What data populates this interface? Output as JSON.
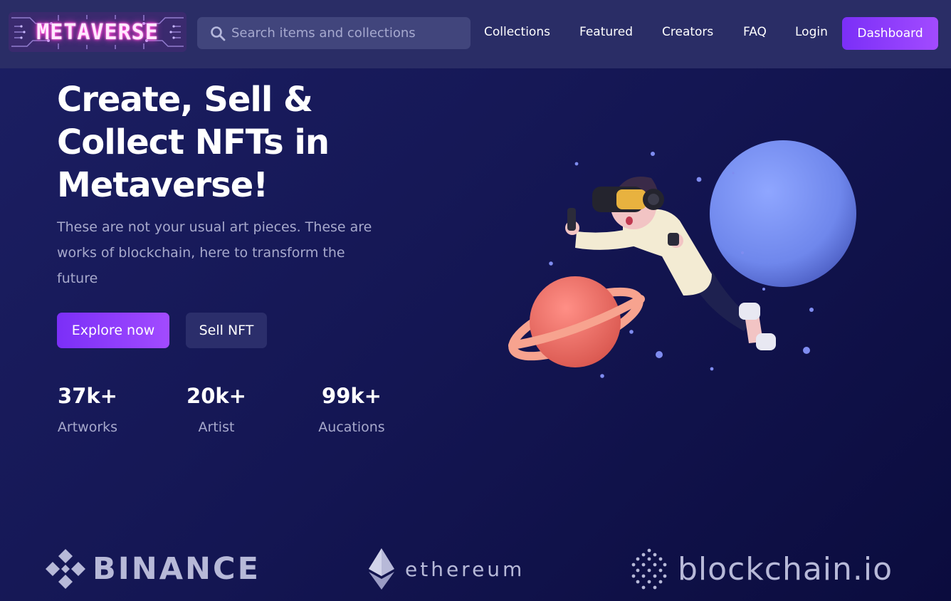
{
  "header": {
    "logo_text": "METAVERSE",
    "search_placeholder": "Search items and collections",
    "nav": [
      {
        "label": "Collections"
      },
      {
        "label": "Featured"
      },
      {
        "label": "Creators"
      },
      {
        "label": "FAQ"
      },
      {
        "label": "Login"
      }
    ],
    "dashboard_label": "Dashboard"
  },
  "hero": {
    "title_lines": [
      "Create, Sell &",
      "Collect NFTs in",
      "Metaverse!"
    ],
    "description_lines": [
      "These are not your usual art pieces. These are",
      "works of blockchain, here to transform the",
      "future"
    ],
    "explore_label": "Explore now",
    "sell_label": "Sell NFT"
  },
  "stats": [
    {
      "value": "37k+",
      "label": "Artworks"
    },
    {
      "value": "20k+",
      "label": "Artist"
    },
    {
      "value": "99k+",
      "label": "Aucations"
    }
  ],
  "partners": [
    {
      "name": "BINANCE",
      "icon": "binance-icon"
    },
    {
      "name": "ethereum",
      "icon": "ethereum-icon"
    },
    {
      "name": "blockchain.io",
      "icon": "blockchain-icon"
    }
  ],
  "colors": {
    "background": "#141653",
    "header": "#2a2d66",
    "accent_start": "#7b2ff7",
    "accent_end": "#a24bff",
    "muted_text": "#a7a9cc",
    "logo_glow": "#ff3dd4"
  }
}
